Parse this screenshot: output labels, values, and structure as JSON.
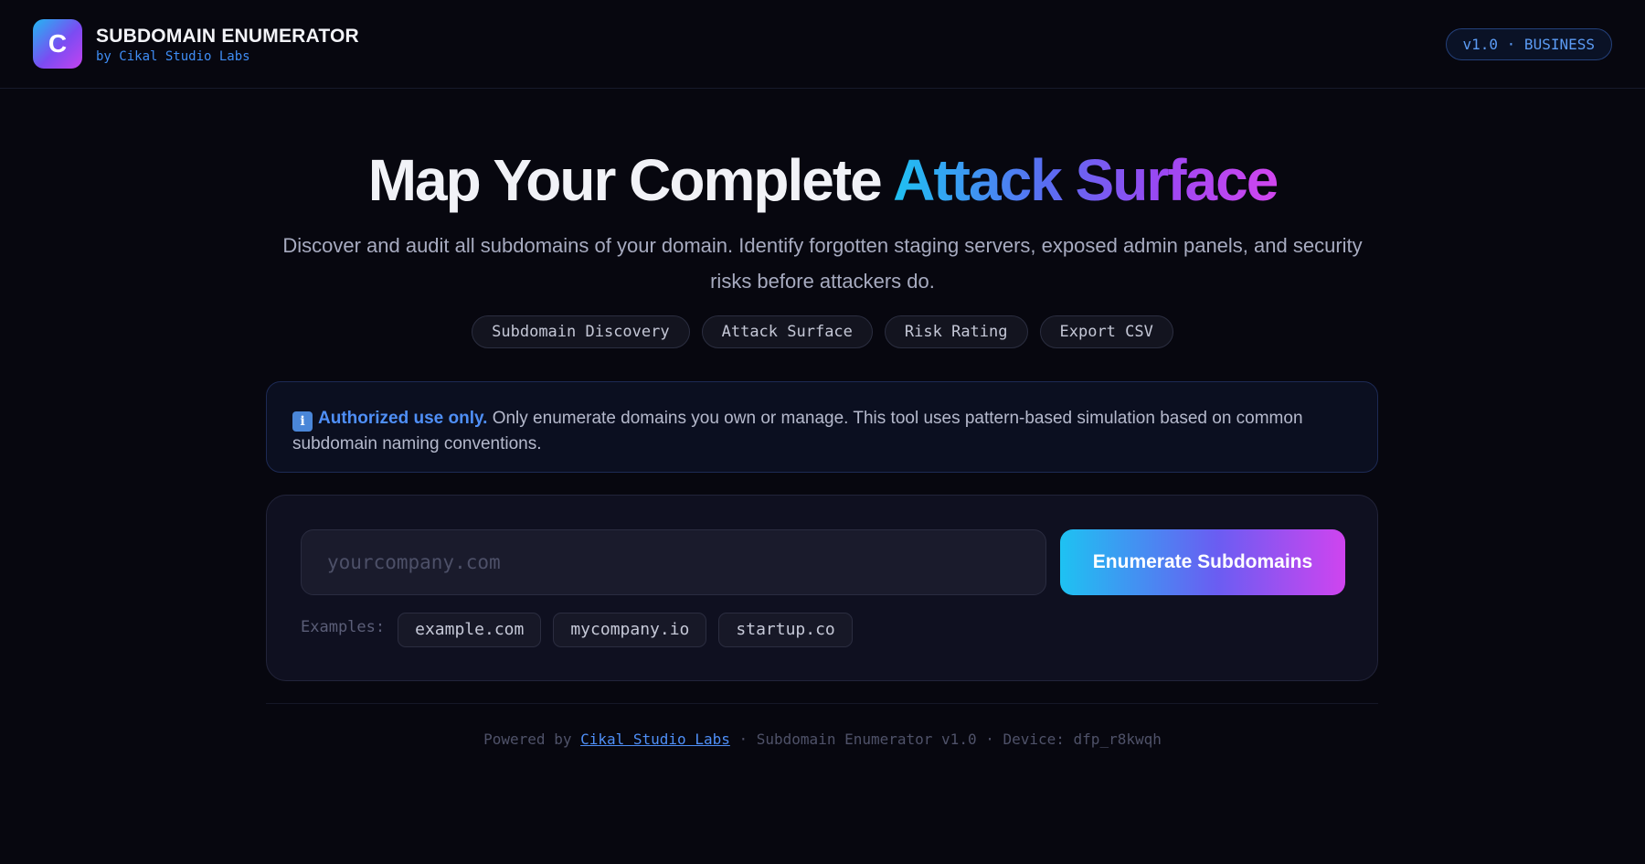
{
  "header": {
    "logo_letter": "C",
    "title": "SUBDOMAIN ENUMERATOR",
    "subtitle": "by Cikal Studio Labs",
    "version_badge": "v1.0 · BUSINESS"
  },
  "hero": {
    "title_plain": "Map Your Complete ",
    "title_gradient": "Attack Surface",
    "description": "Discover and audit all subdomains of your domain. Identify forgotten staging servers, exposed admin panels, and security risks before attackers do."
  },
  "features": [
    "Subdomain Discovery",
    "Attack Surface",
    "Risk Rating",
    "Export CSV"
  ],
  "notice": {
    "icon": "info-icon",
    "strong": "Authorized use only.",
    "text": " Only enumerate domains you own or manage. This tool uses pattern-based simulation based on common subdomain naming conventions."
  },
  "search": {
    "placeholder": "yourcompany.com",
    "value": "",
    "button_label": "Enumerate Subdomains",
    "examples_label": "Examples:",
    "examples": [
      "example.com",
      "mycompany.io",
      "startup.co"
    ]
  },
  "footer": {
    "prefix": "Powered by ",
    "link_text": "Cikal Studio Labs",
    "suffix": " · Subdomain Enumerator v1.0 · Device: dfp_r8kwqh"
  },
  "colors": {
    "background": "#07070f",
    "accent_blue": "#4f8ff7",
    "gradient_start": "#1fc1f2",
    "gradient_end": "#d146ef"
  }
}
